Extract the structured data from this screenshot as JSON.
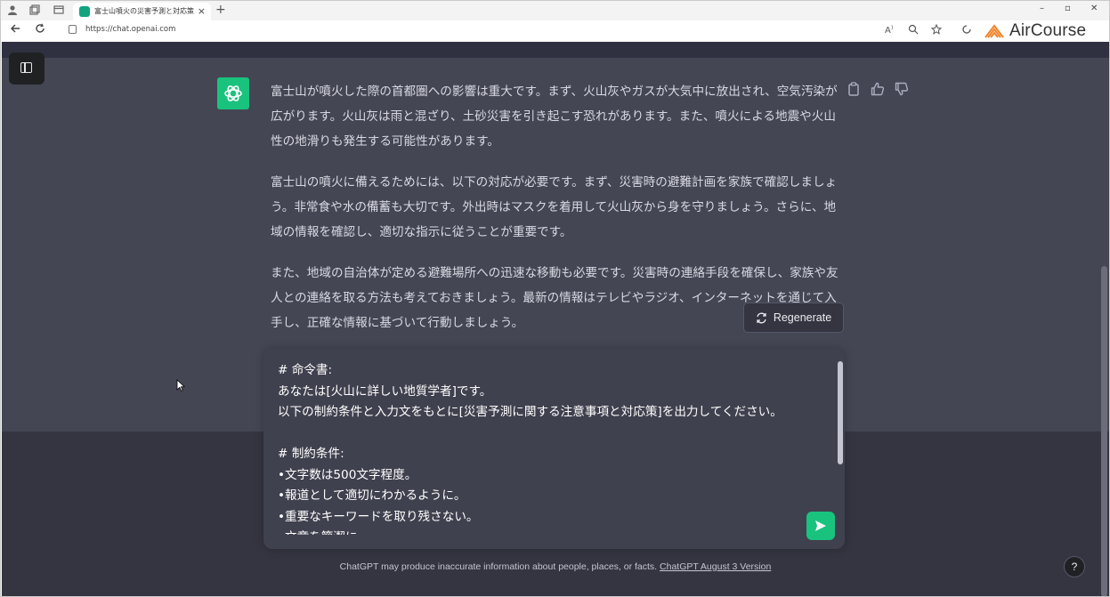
{
  "browser": {
    "tab_title": "富士山噴火の災害予測と対応策",
    "tab_close": "×",
    "new_tab": "+",
    "url": "https://chat.openai.com",
    "window_controls": {
      "minimize": "–",
      "restore": "▫",
      "close": "✕"
    },
    "brand": "AirCourse"
  },
  "chat": {
    "assistant_message": [
      "富士山が噴火した際の首都圏への影響は重大です。まず、火山灰やガスが大気中に放出され、空気汚染が広がります。火山灰は雨と混ざり、土砂災害を引き起こす恐れがあります。また、噴火による地震や火山性の地滑りも発生する可能性があります。",
      "富士山の噴火に備えるためには、以下の対応が必要です。まず、災害時の避難計画を家族で確認しましょう。非常食や水の備蓄も大切です。外出時はマスクを着用して火山灰から身を守りましょう。さらに、地域の情報を確認し、適切な指示に従うことが重要です。",
      "また、地域の自治体が定める避難場所への迅速な移動も必要です。災害時の連絡手段を確保し、家族や友人との連絡を取る方法も考えておきましょう。最新の情報はテレビやラジオ、インターネットを通じて入手し、正確な情報に基づいて行動しましょう。"
    ],
    "regenerate_label": "Regenerate",
    "composer_text": "# 命令書:\nあなたは[火山に詳しい地質学者]です。\n以下の制約条件と入力文をもとに[災害予測に関する注意事項と対応策]を出力してください。\n\n# 制約条件:\n•文字数は500文字程度。\n•報道として適切にわかるように。\n•重要なキーワードを取り残さない。\n•文章を簡潔に。",
    "footer_text": "ChatGPT may produce inaccurate information about people, places, or facts. ",
    "footer_link": "ChatGPT August 3 Version",
    "help_label": "?"
  },
  "colors": {
    "chat_bg": "#444654",
    "composer_bg": "#40414f",
    "accent_green": "#19c37d"
  }
}
